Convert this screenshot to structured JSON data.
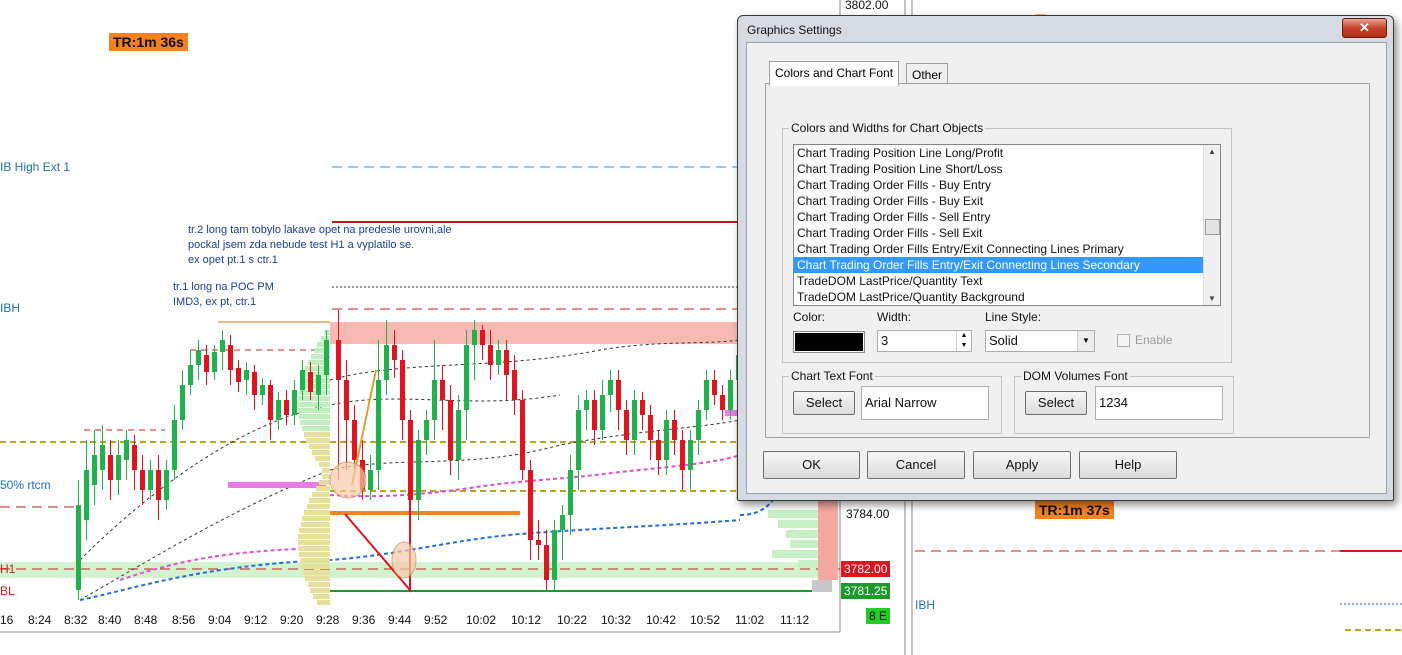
{
  "chart": {
    "tr_badge_left": "TR:1m 36s",
    "tr_badge_right": "TR:1m 37s",
    "labels": {
      "ib_high_ext": "IB High Ext 1",
      "ibh": "IBH",
      "rtcm": "50% rtcm",
      "h1": "H1",
      "bl": "BL",
      "ibh_right": "IBH"
    },
    "notes": {
      "note1": "tr.2 long tam tobylo lakave opet na predesle urovni,ale\npockal jsem zda nebude test H1 a vyplatilo se.\nex opet pt.1 s ctr.1",
      "note2": "tr.1 long na POC PM\nIMD3, ex pt, ctr.1"
    },
    "price_tags": {
      "top": "3802.00",
      "mid": "3784.00",
      "red": "3782.00",
      "green": "3781.25",
      "bottom": "8 E"
    },
    "time_labels": [
      "16",
      "8:24",
      "8:32",
      "8:40",
      "8:48",
      "8:56",
      "9:04",
      "9:12",
      "9:20",
      "9:28",
      "9:36",
      "9:44",
      "9:52",
      "10:02",
      "10:12",
      "10:22",
      "10:32",
      "10:42",
      "10:52",
      "11:02",
      "11:12"
    ],
    "colors": {
      "up": "#22b14c",
      "down": "#e0141e",
      "red_line": "#cc1f1f",
      "olive": "#b3a81a",
      "magenta": "#e04ce0",
      "blue": "#1f6fe0",
      "orange": "#f5821f"
    }
  },
  "dialog": {
    "title": "Graphics Settings",
    "close_label": "✕",
    "tabs": [
      {
        "label": "Colors and Chart Font"
      },
      {
        "label": "Other"
      }
    ],
    "group_objects_title": "Colors and Widths for Chart Objects",
    "list_items": [
      "Chart Trading Position Line Long/Profit",
      "Chart Trading Position Line Short/Loss",
      "Chart Trading Order Fills - Buy Entry",
      "Chart Trading Order Fills - Buy Exit",
      "Chart Trading Order Fills - Sell Entry",
      "Chart Trading Order Fills - Sell Exit",
      "Chart Trading Order Fills Entry/Exit Connecting Lines Primary",
      "Chart Trading Order Fills Entry/Exit Connecting Lines Secondary",
      "TradeDOM LastPrice/Quantity Text",
      "TradeDOM LastPrice/Quantity Background"
    ],
    "color_label": "Color:",
    "color_value": "#000000",
    "width_label": "Width:",
    "width_value": "3",
    "line_style_label": "Line Style:",
    "line_style_value": "Solid",
    "enable_label": "Enable",
    "chart_text_font_title": "Chart Text Font",
    "chart_text_font_value": "Arial Narrow",
    "dom_volumes_font_title": "DOM Volumes Font",
    "dom_volumes_font_value": "1234",
    "select_label": "Select",
    "buttons": {
      "ok": "OK",
      "cancel": "Cancel",
      "apply": "Apply",
      "help": "Help"
    }
  }
}
